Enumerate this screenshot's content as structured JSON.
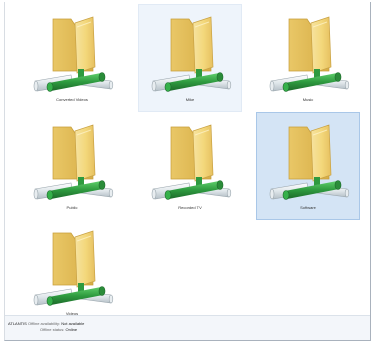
{
  "folders": [
    {
      "label": "Converted Videos"
    },
    {
      "label": "Mike"
    },
    {
      "label": "Music"
    },
    {
      "label": "Public"
    },
    {
      "label": "Recorded TV"
    },
    {
      "label": "Software"
    },
    {
      "label": "Videos"
    }
  ],
  "details_pane": {
    "name": "ATLANTIS",
    "offline_availability_label": "Offline availability:",
    "offline_availability_value": "Not available",
    "offline_status_label": "Offline status:",
    "offline_status_value": "Online"
  },
  "colors": {
    "selection": "#d4e4f5",
    "hover": "#eef4fb",
    "folder": "#f3d77a",
    "pipe": "#2e9a3f"
  },
  "icons": {
    "folder": "network-share-folder-icon"
  }
}
